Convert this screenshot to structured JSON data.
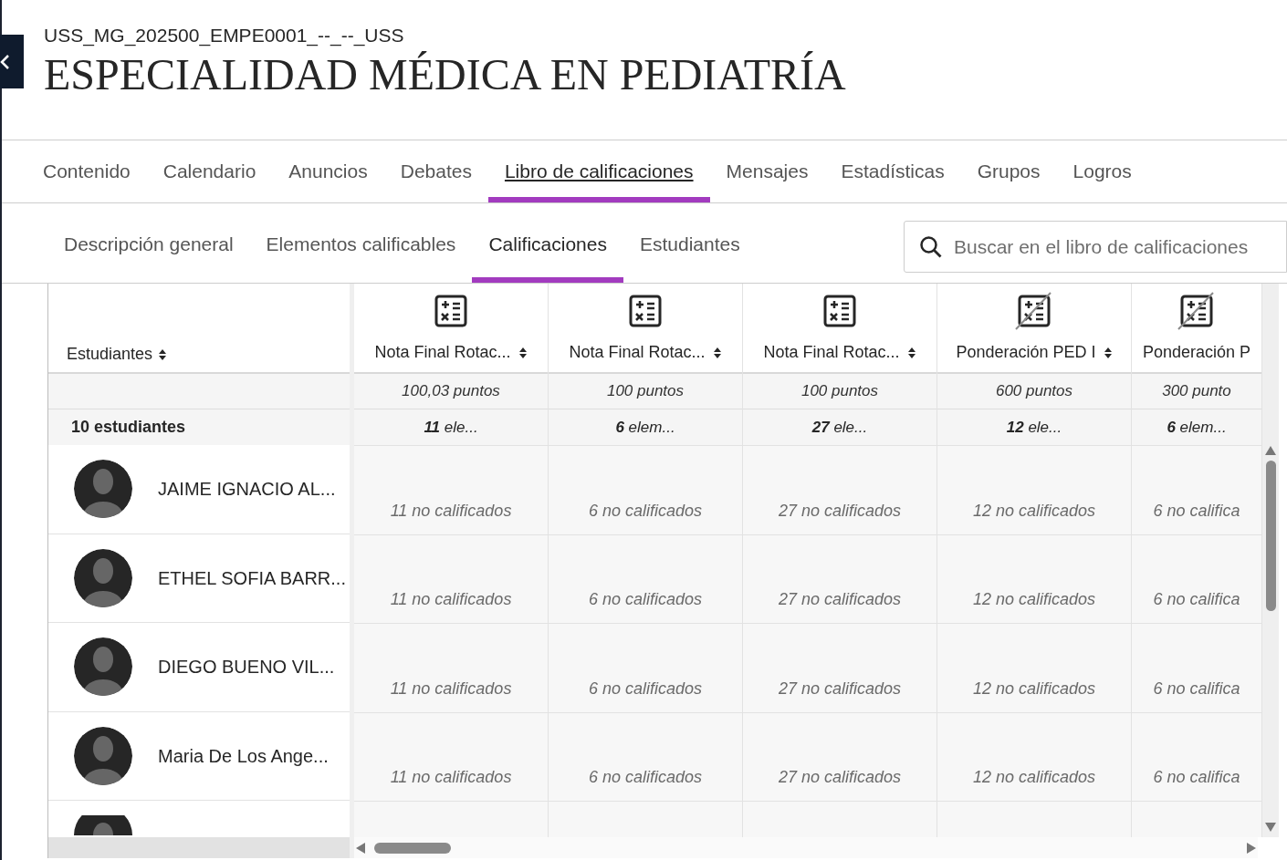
{
  "course": {
    "code": "USS_MG_202500_EMPE0001_--_--_USS",
    "title": "ESPECIALIDAD MÉDICA EN PEDIATRÍA"
  },
  "nav_tabs": [
    {
      "label": "Contenido",
      "selected": false
    },
    {
      "label": "Calendario",
      "selected": false
    },
    {
      "label": "Anuncios",
      "selected": false
    },
    {
      "label": "Debates",
      "selected": false
    },
    {
      "label": "Libro de calificaciones",
      "selected": true
    },
    {
      "label": "Mensajes",
      "selected": false
    },
    {
      "label": "Estadísticas",
      "selected": false
    },
    {
      "label": "Grupos",
      "selected": false
    },
    {
      "label": "Logros",
      "selected": false
    }
  ],
  "sub_tabs": [
    {
      "label": "Descripción general",
      "selected": false
    },
    {
      "label": "Elementos calificables",
      "selected": false
    },
    {
      "label": "Calificaciones",
      "selected": true
    },
    {
      "label": "Estudiantes",
      "selected": false
    }
  ],
  "search": {
    "placeholder": "Buscar en el libro de calificaciones"
  },
  "table": {
    "student_header": "Estudiantes",
    "student_count": "10 estudiantes",
    "columns": [
      {
        "title": "Nota Final Rotac...",
        "hidden": false,
        "sort_shown": true,
        "points": "100,03 puntos",
        "items": "**11** ele..."
      },
      {
        "title": "Nota Final Rotac...",
        "hidden": false,
        "sort_shown": true,
        "points": "100 puntos",
        "items": "**6** elem..."
      },
      {
        "title": "Nota Final Rotac...",
        "hidden": false,
        "sort_shown": true,
        "points": "100 puntos",
        "items": "**27** ele..."
      },
      {
        "title": "Ponderación PED I",
        "hidden": true,
        "sort_shown": true,
        "points": "600 puntos",
        "items": "**12** ele..."
      },
      {
        "title": "Ponderación P",
        "hidden": true,
        "sort_shown": false,
        "points": "300 punto",
        "items": "**6** elem..."
      }
    ],
    "rows": [
      {
        "name": "JAIME IGNACIO AL...",
        "grades": [
          "11 no calificados",
          "6 no calificados",
          "27 no calificados",
          "12 no calificados",
          "6 no califica"
        ]
      },
      {
        "name": "ETHEL SOFIA BARR...",
        "grades": [
          "11 no calificados",
          "6 no calificados",
          "27 no calificados",
          "12 no calificados",
          "6 no califica"
        ]
      },
      {
        "name": "DIEGO BUENO VIL...",
        "grades": [
          "11 no calificados",
          "6 no calificados",
          "27 no calificados",
          "12 no calificados",
          "6 no califica"
        ]
      },
      {
        "name": "Maria De Los Ange...",
        "grades": [
          "11 no calificados",
          "6 no calificados",
          "27 no calificados",
          "12 no calificados",
          "6 no califica"
        ]
      }
    ]
  }
}
